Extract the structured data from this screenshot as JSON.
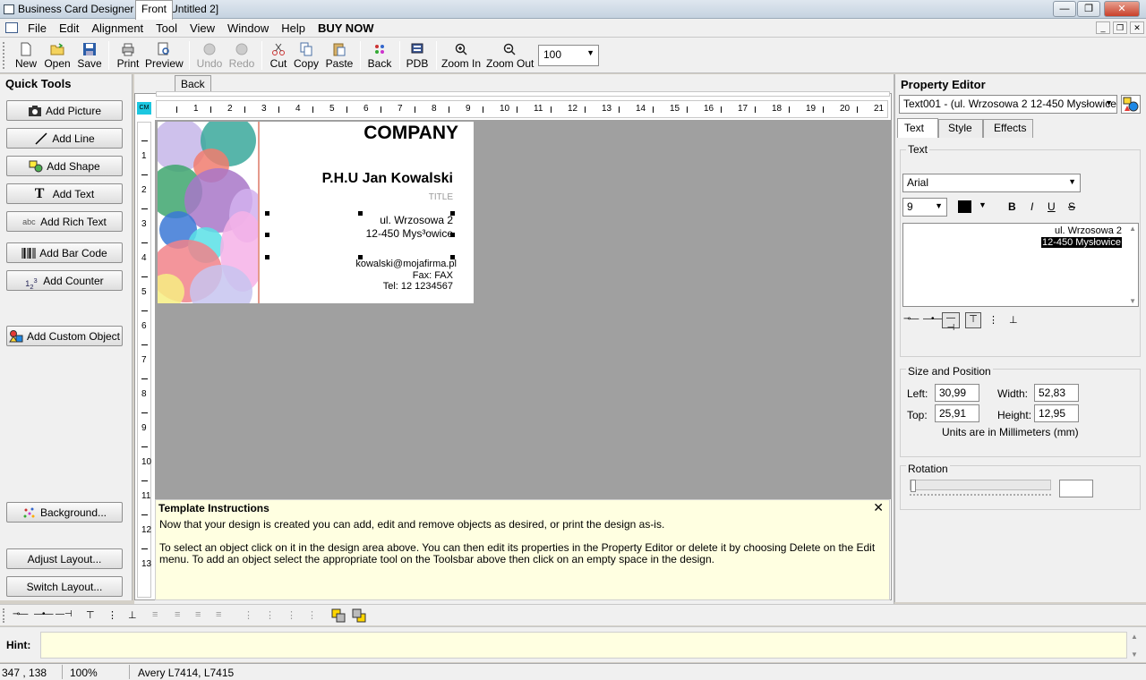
{
  "window": {
    "title": "Business Card Designer Plus  - [Untitled 2]"
  },
  "menu": [
    "File",
    "Edit",
    "Alignment",
    "Tool",
    "View",
    "Window",
    "Help",
    "BUY NOW"
  ],
  "toolbar": {
    "new": "New",
    "open": "Open",
    "save": "Save",
    "print": "Print",
    "preview": "Preview",
    "undo": "Undo",
    "redo": "Redo",
    "cut": "Cut",
    "copy": "Copy",
    "paste": "Paste",
    "back": "Back",
    "pdb": "PDB",
    "zoom_in": "Zoom In",
    "zoom_out": "Zoom Out",
    "zoom_value": "100"
  },
  "quick_tools": {
    "title": "Quick Tools",
    "add_picture": "Add Picture",
    "add_line": "Add Line",
    "add_shape": "Add Shape",
    "add_text": "Add Text",
    "add_rich_text": "Add Rich Text",
    "add_bar_code": "Add Bar Code",
    "add_counter": "Add Counter",
    "add_custom_object": "Add Custom Object",
    "background": "Background...",
    "adjust_layout": "Adjust Layout...",
    "switch_layout": "Switch Layout..."
  },
  "tabs": {
    "front": "Front",
    "back": "Back"
  },
  "ruler": {
    "unit": "CM",
    "h": [
      "1",
      "2",
      "3",
      "4",
      "5",
      "6",
      "7",
      "8",
      "9",
      "10",
      "11",
      "12",
      "13",
      "14",
      "15",
      "16",
      "17",
      "18",
      "19",
      "20",
      "21"
    ],
    "v": [
      "1",
      "2",
      "3",
      "4",
      "5",
      "6",
      "7",
      "8",
      "9",
      "10",
      "11",
      "12",
      "13"
    ]
  },
  "card": {
    "company": "COMPANY",
    "name": "P.H.U Jan Kowalski",
    "title": "TITLE",
    "street": "ul. Wrzosowa 2",
    "city": "12-450 Mys³owice",
    "email": "kowalski@mojafirma.pl",
    "fax": "Fax: FAX",
    "tel": "Tel: 12 1234567"
  },
  "instructions": {
    "title": "Template Instructions",
    "p1": "Now that your design is created you can add, edit and remove objects as desired, or print the design as-is.",
    "p2": "To select an object click on it in the design area above. You can then edit its properties in the Property Editor or delete it by choosing Delete on the Edit menu. To add an object select the appropriate tool on the Toolsbar above then click on an empty space in the design."
  },
  "property_editor": {
    "title": "Property Editor",
    "object_select": "Text001 - (ul. Wrzosowa 2 12-450 Mysłowice)",
    "tabs": [
      "Text",
      "Style",
      "Effects"
    ],
    "text_group": "Text",
    "font": "Arial",
    "size": "9",
    "bold": "B",
    "italic": "I",
    "underline": "U",
    "strike": "S",
    "text_line1": "ul. Wrzosowa 2",
    "text_line2": "12-450 Mysłowice",
    "size_position": "Size and Position",
    "left_label": "Left:",
    "left": "30,99",
    "width_label": "Width:",
    "width": "52,83",
    "top_label": "Top:",
    "top": "25,91",
    "height_label": "Height:",
    "height": "12,95",
    "units": "Units are in Millimeters (mm)",
    "rotation": "Rotation"
  },
  "hint": {
    "label": "Hint:",
    "value": ""
  },
  "status": {
    "coords": "347 , 138",
    "zoom": "100%",
    "layout": "Avery L7414, L7415"
  },
  "colors": {
    "accent": "#1cc7e0",
    "canvas": "#a0a0a0",
    "instructions_bg": "#ffffe1",
    "selection": "#000000"
  }
}
